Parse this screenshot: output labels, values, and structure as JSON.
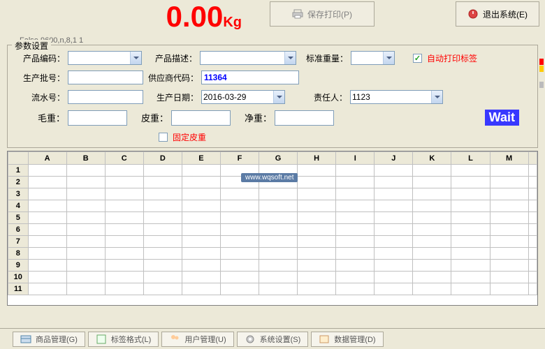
{
  "weight": {
    "value": "0.00",
    "unit": "Kg",
    "status": "False 9600,n,8,1 1"
  },
  "buttons": {
    "savePrint": "保存打印(P)",
    "exit": "退出系统(E)"
  },
  "fieldset": {
    "legend": "参数设置"
  },
  "labels": {
    "productCode": "产品编码：",
    "productDesc": "产品描述：",
    "stdWeight": "标准重量：",
    "autoPrint": "自动打印标签",
    "batch": "生产批号：",
    "supplier": "供应商代码：",
    "serial": "流水号：",
    "prodDate": "生产日期：",
    "owner": "责任人：",
    "gross": "毛重：",
    "tare": "皮重：",
    "net": "净重：",
    "fixTare": "固定皮重"
  },
  "values": {
    "supplier": "11364",
    "prodDate": "2016-03-29",
    "owner": "1123"
  },
  "status": {
    "wait": "Wait"
  },
  "watermark": "www.wqsoft.net",
  "grid": {
    "cols": [
      "",
      "A",
      "B",
      "C",
      "D",
      "E",
      "F",
      "G",
      "H",
      "I",
      "J",
      "K",
      "L",
      "M",
      ""
    ],
    "rows": [
      "1",
      "2",
      "3",
      "4",
      "5",
      "6",
      "7",
      "8",
      "9",
      "10",
      "11"
    ]
  },
  "toolbar": [
    "商品管理(G)",
    "标签格式(L)",
    "用户管理(U)",
    "系统设置(S)",
    "数据管理(D)"
  ]
}
